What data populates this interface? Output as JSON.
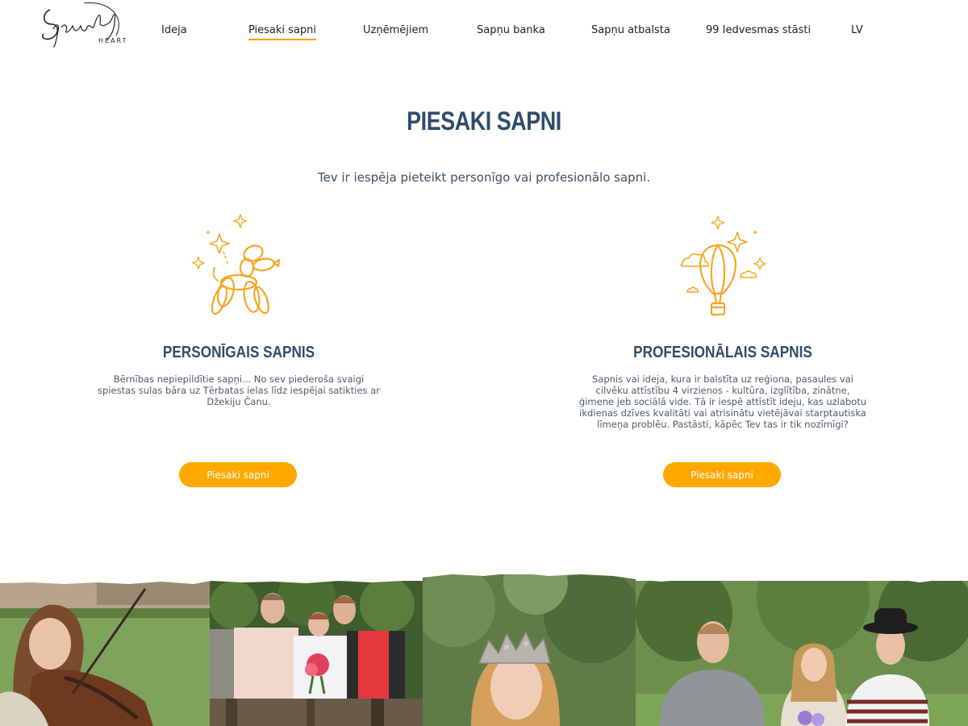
{
  "brand": {
    "logo_script": "Sparkle",
    "logo_sub": "HEART"
  },
  "nav": {
    "items": [
      {
        "label": "Ideja"
      },
      {
        "label": "Piesaki sapni"
      },
      {
        "label": "Uzņēmējiem"
      },
      {
        "label": "Sapņu banka"
      },
      {
        "label": "Sapņu atbalsta"
      },
      {
        "label": "99 Iedvesmas stāsti"
      },
      {
        "label": "LV"
      }
    ],
    "active_index": 1
  },
  "hero": {
    "title": "PIESAKI SAPNI",
    "subtitle": "Tev ir iespēja pieteikt personīgo vai profesionālo sapni."
  },
  "cards": [
    {
      "icon": "balloon-dog-icon",
      "title": "PERSONĪGAIS SAPNIS",
      "text": "Bērnības nepiepildītie sapņi... No sev piederoša svaigi spiestas sulas bāra uz Tērbatas ielas līdz iespējai satikties ar Džekiju Čanu.",
      "button": "Piesaki sapni"
    },
    {
      "icon": "hot-air-balloon-icon",
      "title": "PROFESIONĀLAIS SAPNIS",
      "text": "Sapnis vai ideja, kura ir balstīta uz reģiona, pasaules vai cilvēku attīstību 4 virzienos - kultūra, izglītība, zinātne, ģimene jeb sociālā vide. Tā ir iespē attīstīt ideju, kas uzlabotu ikdienas dzīves kvalitāti vai atrisinātu vietējāvai starptautiska līmeņa problēu. Pastāsti, kāpēc Tev tas ir tik nozīmīgi?",
      "button": "Piesaki sapni"
    }
  ],
  "colors": {
    "accent": "#ffa800",
    "title": "#2f4c6b",
    "icon_stroke": "#f5a623"
  },
  "photos": [
    {
      "name": "violinist-photo"
    },
    {
      "name": "group-with-flowers-photo"
    },
    {
      "name": "woman-with-crown-photo"
    },
    {
      "name": "three-friends-photo"
    }
  ]
}
